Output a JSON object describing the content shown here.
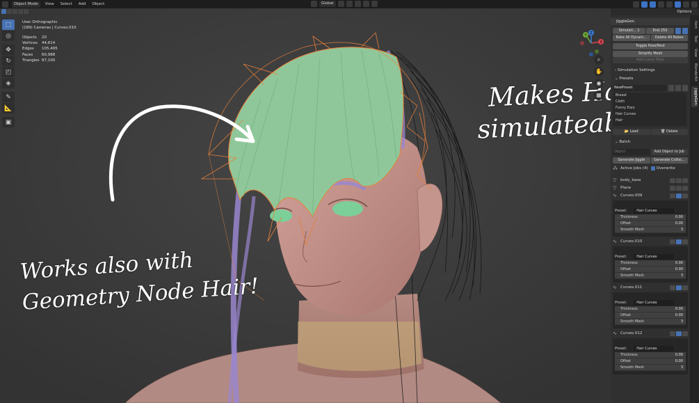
{
  "header": {
    "mode": "Object Mode",
    "menu": [
      "View",
      "Select",
      "Add",
      "Object"
    ],
    "transform_orientation": "Global"
  },
  "viewport": {
    "view_name": "User Orthographic",
    "collection_line": "(189) Cameras | Curves.010",
    "stats": [
      {
        "label": "Objects",
        "value": "20"
      },
      {
        "label": "Vertices",
        "value": "44,614"
      },
      {
        "label": "Edges",
        "value": "105,495"
      },
      {
        "label": "Faces",
        "value": "60,988"
      },
      {
        "label": "Triangles",
        "value": "87,100"
      }
    ],
    "annotation_right": [
      "Makes Hair",
      "simulateable!"
    ],
    "annotation_left": [
      "Works also with",
      "Geometry Node Hair!"
    ],
    "gizmo_axes": {
      "x": "X",
      "y": "Y",
      "z": "Z"
    }
  },
  "sidebar": {
    "options_label": "Options",
    "tabs": [
      "Item",
      "Tool",
      "View",
      "BlenderKit",
      "JiggleGen"
    ],
    "panel_title": "JiggleGen",
    "sim_label": "Simulati...",
    "sim_start": "1",
    "sim_end_label": "End",
    "sim_end": "250",
    "bake_all": "Bake All Dynam...",
    "delete_all": "Delete All Bakes",
    "toggle_pose": "Toggle Pose/Rest",
    "simplify_mesh": "Simplify Mesh",
    "add_curve_tools": "Add Curve Tools",
    "simulation_settings": "Simulation Settings",
    "presets_title": "Presets",
    "preset_name": "NewPreset",
    "presets": [
      "Breast",
      "Cloth",
      "Funny Ears",
      "Hair Curves",
      "Hair"
    ],
    "load_label": "Load",
    "delete_label": "Delete",
    "batch_title": "Batch",
    "object_placeholder": "Object",
    "add_object_to_job": "Add Object to Job",
    "generate_jiggle": "Generate Jiggle",
    "generate_collision": "Generate Collisi...",
    "active_jobs": "Active Jobs (4)",
    "overwrite": "Overwrite",
    "objects": [
      "body_base",
      "Plane"
    ],
    "preset_label": "Preset:",
    "jobs": [
      {
        "name": "Curves.009",
        "preset": "Hair Curves",
        "thickness": "0.00",
        "offset": "0.00",
        "smooth": "3"
      },
      {
        "name": "Curves.010",
        "preset": "Hair Curves",
        "thickness": "0.00",
        "offset": "0.00",
        "smooth": "3"
      },
      {
        "name": "Curves.011",
        "preset": "Hair Curves",
        "thickness": "0.00",
        "offset": "0.00",
        "smooth": "3"
      },
      {
        "name": "Curves.012",
        "preset": "Hair Curves",
        "thickness": "0.00",
        "offset": "0.00",
        "smooth": "3"
      }
    ],
    "field_labels": {
      "thickness": "Thickness",
      "offset": "Offset",
      "smooth": "Smooth Mesh"
    }
  },
  "colors": {
    "accent": "#4772b3",
    "hair_green": "#8fc79a",
    "hair_orange": "#e8803a",
    "skin": "#c99a92"
  }
}
